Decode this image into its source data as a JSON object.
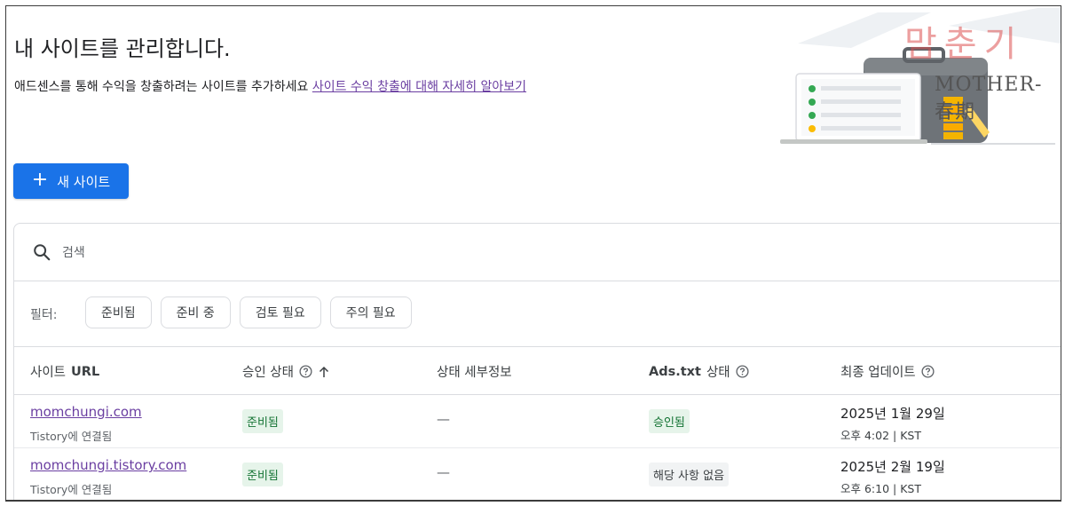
{
  "header": {
    "title": "내 사이트를 관리합니다.",
    "description": "애드센스를 통해 수익을 창출하려는 사이트를 추가하세요",
    "learn_more_link": "사이트 수익 창출에 대해 자세히 알아보기"
  },
  "watermark": {
    "text_main": "맘춘기",
    "text_sub": "MOTHER-春期"
  },
  "actions": {
    "new_site_label": "새 사이트",
    "new_site_icon": "plus-icon"
  },
  "search": {
    "placeholder": "검색",
    "icon": "search-icon"
  },
  "filters": {
    "label": "필터:",
    "chips": [
      "준비됨",
      "준비 중",
      "검토 필요",
      "주의 필요"
    ]
  },
  "table": {
    "columns": {
      "site_url_prefix": "사이트",
      "site_url_bold": "URL",
      "approval": "승인 상태",
      "details": "상태 세부정보",
      "ads_txt_bold": "Ads.txt",
      "ads_txt_suffix": "상태",
      "last_update": "최종 업데이트"
    },
    "rows": [
      {
        "url": "momchungi.com",
        "connected": "Tistory에 연결됨",
        "approval": "준비됨",
        "details": "—",
        "ads_txt": "승인됨",
        "date": "2025년 1월 29일",
        "time": "오후 4:02 | KST"
      },
      {
        "url": "momchungi.tistory.com",
        "connected": "Tistory에 연결됨",
        "approval": "준비됨",
        "details": "—",
        "ads_txt": "해당 사항 없음",
        "date": "2025년 2월 19일",
        "time": "오후 6:10 | KST"
      }
    ]
  },
  "colors": {
    "primary": "#1a73e8",
    "link": "#6a3ea1",
    "ready_bg": "#e6f4ea",
    "ready_text": "#137333",
    "neutral_bg": "#f1f3f4"
  }
}
